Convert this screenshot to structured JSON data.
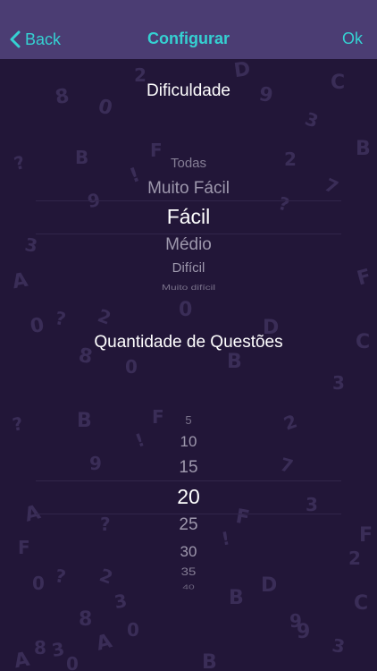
{
  "nav": {
    "back_label": "Back",
    "title": "Configurar",
    "ok_label": "Ok"
  },
  "difficulty": {
    "title": "Dificuldade",
    "options": [
      "Todas",
      "Muito Fácil",
      "Fácil",
      "Médio",
      "Difícil",
      "Muito difícil"
    ],
    "selected": "Fácil"
  },
  "quantity": {
    "title": "Quantidade de Questões",
    "options": [
      "5",
      "10",
      "15",
      "20",
      "25",
      "30",
      "35",
      "40"
    ],
    "selected": "20"
  },
  "background_glyphs": [
    "8",
    "0",
    "2",
    "D",
    "9",
    "C",
    "3",
    "B",
    "?",
    "B",
    "!",
    "F",
    "2",
    "?",
    "9",
    "7",
    "3",
    "A",
    "F",
    "0",
    "?",
    "2",
    "0",
    "D",
    "C",
    "8",
    "0",
    "B",
    "3",
    "?",
    "B",
    "!",
    "F",
    "9",
    "7",
    "2",
    "F",
    "3",
    "A",
    "?",
    "F",
    "F",
    "2",
    "!",
    "0",
    "?",
    "2",
    "B",
    "A",
    "D",
    "9",
    "8",
    "3",
    "0",
    "C",
    "A",
    "8",
    "3",
    "0",
    "9",
    "3",
    "B"
  ],
  "colors": {
    "background": "#221638",
    "nav_background": "#4b3d73",
    "accent": "#35d1d2",
    "glyph": "#3a2d57"
  }
}
